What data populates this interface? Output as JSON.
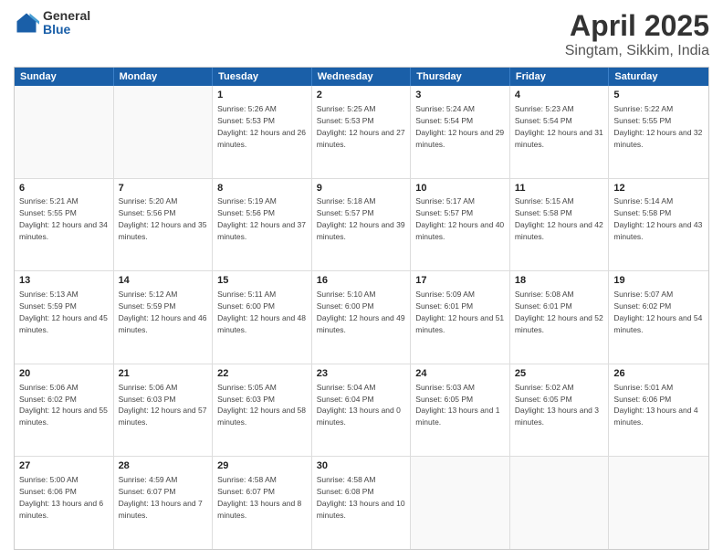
{
  "header": {
    "logo": {
      "general": "General",
      "blue": "Blue"
    },
    "title": "April 2025",
    "subtitle": "Singtam, Sikkim, India"
  },
  "calendar": {
    "days": [
      "Sunday",
      "Monday",
      "Tuesday",
      "Wednesday",
      "Thursday",
      "Friday",
      "Saturday"
    ],
    "rows": [
      [
        {
          "day": "",
          "empty": true
        },
        {
          "day": "",
          "empty": true
        },
        {
          "day": "1",
          "sunrise": "Sunrise: 5:26 AM",
          "sunset": "Sunset: 5:53 PM",
          "daylight": "Daylight: 12 hours and 26 minutes."
        },
        {
          "day": "2",
          "sunrise": "Sunrise: 5:25 AM",
          "sunset": "Sunset: 5:53 PM",
          "daylight": "Daylight: 12 hours and 27 minutes."
        },
        {
          "day": "3",
          "sunrise": "Sunrise: 5:24 AM",
          "sunset": "Sunset: 5:54 PM",
          "daylight": "Daylight: 12 hours and 29 minutes."
        },
        {
          "day": "4",
          "sunrise": "Sunrise: 5:23 AM",
          "sunset": "Sunset: 5:54 PM",
          "daylight": "Daylight: 12 hours and 31 minutes."
        },
        {
          "day": "5",
          "sunrise": "Sunrise: 5:22 AM",
          "sunset": "Sunset: 5:55 PM",
          "daylight": "Daylight: 12 hours and 32 minutes."
        }
      ],
      [
        {
          "day": "6",
          "sunrise": "Sunrise: 5:21 AM",
          "sunset": "Sunset: 5:55 PM",
          "daylight": "Daylight: 12 hours and 34 minutes."
        },
        {
          "day": "7",
          "sunrise": "Sunrise: 5:20 AM",
          "sunset": "Sunset: 5:56 PM",
          "daylight": "Daylight: 12 hours and 35 minutes."
        },
        {
          "day": "8",
          "sunrise": "Sunrise: 5:19 AM",
          "sunset": "Sunset: 5:56 PM",
          "daylight": "Daylight: 12 hours and 37 minutes."
        },
        {
          "day": "9",
          "sunrise": "Sunrise: 5:18 AM",
          "sunset": "Sunset: 5:57 PM",
          "daylight": "Daylight: 12 hours and 39 minutes."
        },
        {
          "day": "10",
          "sunrise": "Sunrise: 5:17 AM",
          "sunset": "Sunset: 5:57 PM",
          "daylight": "Daylight: 12 hours and 40 minutes."
        },
        {
          "day": "11",
          "sunrise": "Sunrise: 5:15 AM",
          "sunset": "Sunset: 5:58 PM",
          "daylight": "Daylight: 12 hours and 42 minutes."
        },
        {
          "day": "12",
          "sunrise": "Sunrise: 5:14 AM",
          "sunset": "Sunset: 5:58 PM",
          "daylight": "Daylight: 12 hours and 43 minutes."
        }
      ],
      [
        {
          "day": "13",
          "sunrise": "Sunrise: 5:13 AM",
          "sunset": "Sunset: 5:59 PM",
          "daylight": "Daylight: 12 hours and 45 minutes."
        },
        {
          "day": "14",
          "sunrise": "Sunrise: 5:12 AM",
          "sunset": "Sunset: 5:59 PM",
          "daylight": "Daylight: 12 hours and 46 minutes."
        },
        {
          "day": "15",
          "sunrise": "Sunrise: 5:11 AM",
          "sunset": "Sunset: 6:00 PM",
          "daylight": "Daylight: 12 hours and 48 minutes."
        },
        {
          "day": "16",
          "sunrise": "Sunrise: 5:10 AM",
          "sunset": "Sunset: 6:00 PM",
          "daylight": "Daylight: 12 hours and 49 minutes."
        },
        {
          "day": "17",
          "sunrise": "Sunrise: 5:09 AM",
          "sunset": "Sunset: 6:01 PM",
          "daylight": "Daylight: 12 hours and 51 minutes."
        },
        {
          "day": "18",
          "sunrise": "Sunrise: 5:08 AM",
          "sunset": "Sunset: 6:01 PM",
          "daylight": "Daylight: 12 hours and 52 minutes."
        },
        {
          "day": "19",
          "sunrise": "Sunrise: 5:07 AM",
          "sunset": "Sunset: 6:02 PM",
          "daylight": "Daylight: 12 hours and 54 minutes."
        }
      ],
      [
        {
          "day": "20",
          "sunrise": "Sunrise: 5:06 AM",
          "sunset": "Sunset: 6:02 PM",
          "daylight": "Daylight: 12 hours and 55 minutes."
        },
        {
          "day": "21",
          "sunrise": "Sunrise: 5:06 AM",
          "sunset": "Sunset: 6:03 PM",
          "daylight": "Daylight: 12 hours and 57 minutes."
        },
        {
          "day": "22",
          "sunrise": "Sunrise: 5:05 AM",
          "sunset": "Sunset: 6:03 PM",
          "daylight": "Daylight: 12 hours and 58 minutes."
        },
        {
          "day": "23",
          "sunrise": "Sunrise: 5:04 AM",
          "sunset": "Sunset: 6:04 PM",
          "daylight": "Daylight: 13 hours and 0 minutes."
        },
        {
          "day": "24",
          "sunrise": "Sunrise: 5:03 AM",
          "sunset": "Sunset: 6:05 PM",
          "daylight": "Daylight: 13 hours and 1 minute."
        },
        {
          "day": "25",
          "sunrise": "Sunrise: 5:02 AM",
          "sunset": "Sunset: 6:05 PM",
          "daylight": "Daylight: 13 hours and 3 minutes."
        },
        {
          "day": "26",
          "sunrise": "Sunrise: 5:01 AM",
          "sunset": "Sunset: 6:06 PM",
          "daylight": "Daylight: 13 hours and 4 minutes."
        }
      ],
      [
        {
          "day": "27",
          "sunrise": "Sunrise: 5:00 AM",
          "sunset": "Sunset: 6:06 PM",
          "daylight": "Daylight: 13 hours and 6 minutes."
        },
        {
          "day": "28",
          "sunrise": "Sunrise: 4:59 AM",
          "sunset": "Sunset: 6:07 PM",
          "daylight": "Daylight: 13 hours and 7 minutes."
        },
        {
          "day": "29",
          "sunrise": "Sunrise: 4:58 AM",
          "sunset": "Sunset: 6:07 PM",
          "daylight": "Daylight: 13 hours and 8 minutes."
        },
        {
          "day": "30",
          "sunrise": "Sunrise: 4:58 AM",
          "sunset": "Sunset: 6:08 PM",
          "daylight": "Daylight: 13 hours and 10 minutes."
        },
        {
          "day": "",
          "empty": true
        },
        {
          "day": "",
          "empty": true
        },
        {
          "day": "",
          "empty": true
        }
      ]
    ]
  }
}
